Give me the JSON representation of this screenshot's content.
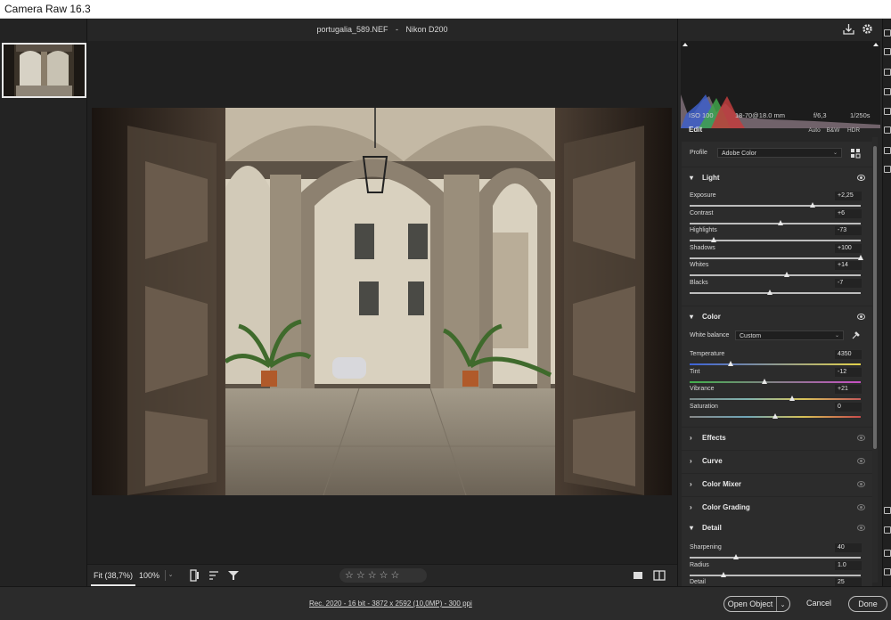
{
  "window": {
    "title": "Camera Raw 16.3"
  },
  "header": {
    "filename": "portugalia_589.NEF",
    "separator": "-",
    "camera": "Nikon D200"
  },
  "canvas_toolbar": {
    "fit_label": "Fit (38,7%)",
    "zoom_label": "100%",
    "rating_stars": "☆☆☆☆☆"
  },
  "status_bar": {
    "workflow_link": "Rec. 2020 - 16 bit - 3872 x 2592 (10,0MP) - 300 ppi",
    "open_button": "Open Object",
    "cancel_button": "Cancel",
    "done_button": "Done"
  },
  "histogram": {
    "iso": "ISO 100",
    "lens": "18-70@18.0 mm",
    "aperture": "f/6,3",
    "shutter": "1/250s"
  },
  "edit": {
    "title": "Edit",
    "auto": "Auto",
    "bw": "B&W",
    "hdr": "HDR"
  },
  "profile": {
    "label": "Profile",
    "value": "Adobe Color"
  },
  "light": {
    "title": "Light",
    "sliders": [
      {
        "label": "Exposure",
        "value": "+2,25",
        "position": 0.72
      },
      {
        "label": "Contrast",
        "value": "+6",
        "position": 0.53
      },
      {
        "label": "Highlights",
        "value": "-73",
        "position": 0.14
      },
      {
        "label": "Shadows",
        "value": "+100",
        "position": 1.0
      },
      {
        "label": "Whites",
        "value": "+14",
        "position": 0.57
      },
      {
        "label": "Blacks",
        "value": "-7",
        "position": 0.47
      }
    ]
  },
  "color": {
    "title": "Color",
    "white_balance_label": "White balance",
    "white_balance_value": "Custom",
    "sliders": [
      {
        "label": "Temperature",
        "value": "4350",
        "position": 0.24
      },
      {
        "label": "Tint",
        "value": "-12",
        "position": 0.44
      },
      {
        "label": "Vibrance",
        "value": "+21",
        "position": 0.6
      },
      {
        "label": "Saturation",
        "value": "0",
        "position": 0.5
      }
    ]
  },
  "collapsed_sections": [
    "Effects",
    "Curve",
    "Color Mixer",
    "Color Grading"
  ],
  "detail": {
    "title": "Detail",
    "sliders": [
      {
        "label": "Sharpening",
        "value": "40",
        "position": 0.27
      },
      {
        "label": "Radius",
        "value": "1.0",
        "position": 0.2
      },
      {
        "label": "Detail",
        "value": "25",
        "position": 0.25
      }
    ]
  },
  "colors": {
    "panel_bg": "#262626",
    "section_bg": "#2c2c2c",
    "title_bar_bg": "#ffffff",
    "temp_gradient_start": "#3b62d8",
    "temp_gradient_end": "#e3d24a",
    "tint_gradient_start": "#41b04b",
    "tint_gradient_end": "#c74fc4"
  }
}
